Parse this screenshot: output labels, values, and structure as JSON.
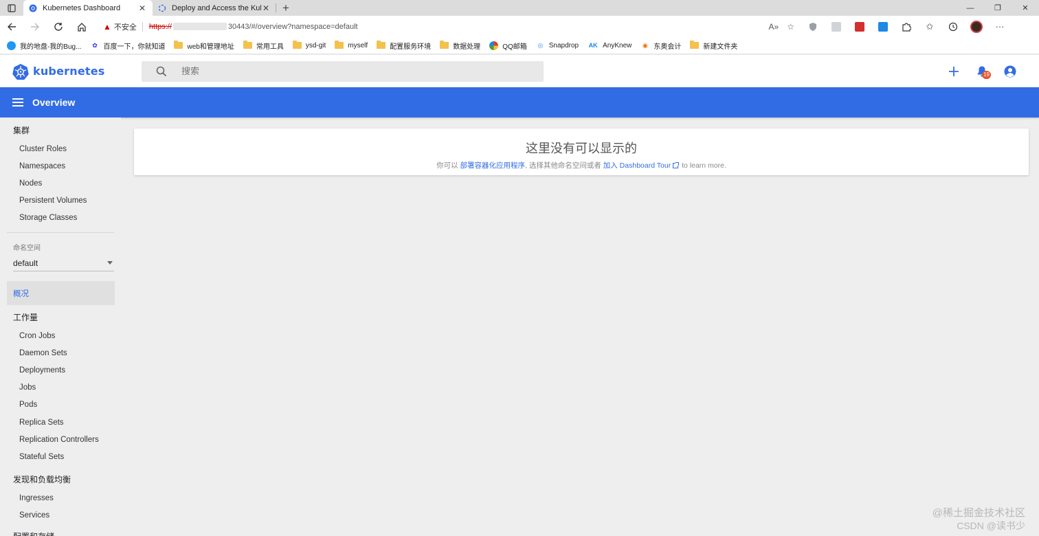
{
  "browser": {
    "tabs": [
      {
        "title": "Kubernetes Dashboard",
        "active": true
      },
      {
        "title": "Deploy and Access the Kubernet",
        "active": false
      }
    ],
    "new_tab": "+",
    "window_controls": {
      "minimize": "—",
      "restore": "❐",
      "close": "✕"
    },
    "address": {
      "security_label": "不安全",
      "scheme": "https://",
      "url_rest": "30443/#/overview?namespace=default"
    },
    "bookmarks": [
      {
        "label": "我的地盘-我的Bug...",
        "icon": "globe-icon"
      },
      {
        "label": "百度一下，你就知道",
        "icon": "baidu-icon"
      },
      {
        "label": "web和管理地址",
        "icon": "folder-icon"
      },
      {
        "label": "常用工具",
        "icon": "folder-icon"
      },
      {
        "label": "ysd-git",
        "icon": "folder-icon"
      },
      {
        "label": "myself",
        "icon": "folder-icon"
      },
      {
        "label": "配置服务环境",
        "icon": "folder-icon"
      },
      {
        "label": "数据处理",
        "icon": "folder-icon"
      },
      {
        "label": "QQ邮箱",
        "icon": "qq-mail-icon"
      },
      {
        "label": "Snapdrop",
        "icon": "snapdrop-icon"
      },
      {
        "label": "AnyKnew",
        "icon": "anyknew-icon"
      },
      {
        "label": "东奥会计",
        "icon": "dongao-icon"
      },
      {
        "label": "新建文件夹",
        "icon": "folder-icon"
      }
    ]
  },
  "header": {
    "brand": "kubernetes",
    "search_placeholder": "搜索",
    "notification_count": "19"
  },
  "titlebar": {
    "title": "Overview"
  },
  "sidebar": {
    "cluster": {
      "title": "集群",
      "items": [
        "Cluster Roles",
        "Namespaces",
        "Nodes",
        "Persistent Volumes",
        "Storage Classes"
      ]
    },
    "namespace": {
      "label": "命名空间",
      "value": "default"
    },
    "overview": "概况",
    "workloads": {
      "title": "工作量",
      "items": [
        "Cron Jobs",
        "Daemon Sets",
        "Deployments",
        "Jobs",
        "Pods",
        "Replica Sets",
        "Replication Controllers",
        "Stateful Sets"
      ]
    },
    "discovery": {
      "title": "发现和负载均衡",
      "items": [
        "Ingresses",
        "Services"
      ]
    },
    "config": {
      "title": "配置和存储"
    }
  },
  "main": {
    "empty_title": "这里没有可以显示的",
    "msg_prefix": "你可以 ",
    "deploy_link": "部署容器化应用程序",
    "msg_mid": ", 选择其他命名空间或者 ",
    "tour_link": "加入 Dashboard Tour",
    "msg_suffix": " to learn more."
  },
  "watermark": {
    "line1": "@稀土掘金技术社区",
    "line2": "CSDN @读书少"
  },
  "colors": {
    "k8s_blue": "#326ce5",
    "badge": "#e5532d",
    "sidebar_bg": "#eeeeee"
  }
}
